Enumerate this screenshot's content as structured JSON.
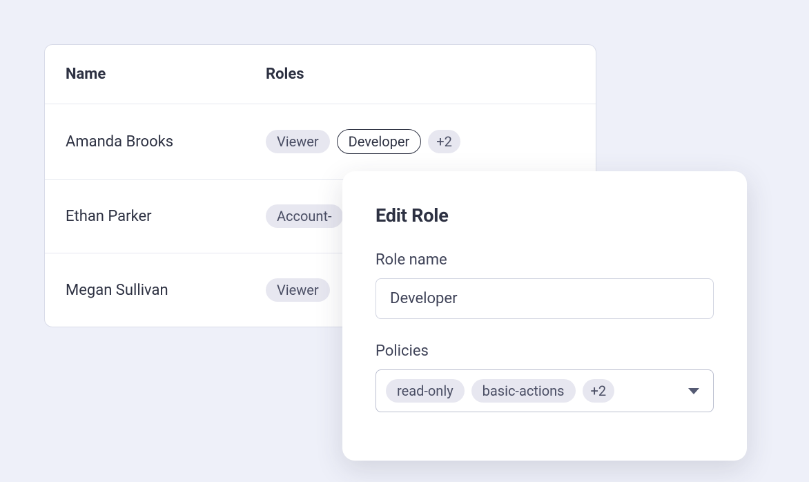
{
  "table": {
    "headers": {
      "name": "Name",
      "roles": "Roles"
    },
    "rows": [
      {
        "name": "Amanda Brooks",
        "roles": [
          "Viewer",
          "Developer"
        ],
        "extraCount": "+2",
        "highlightedIndex": 1
      },
      {
        "name": "Ethan Parker",
        "roles": [
          "Account-"
        ],
        "extraCount": null
      },
      {
        "name": "Megan Sullivan",
        "roles": [
          "Viewer"
        ],
        "extraCount": null
      }
    ]
  },
  "popover": {
    "title": "Edit Role",
    "roleNameLabel": "Role name",
    "roleNameValue": "Developer",
    "policiesLabel": "Policies",
    "policies": [
      "read-only",
      "basic-actions"
    ],
    "policiesExtra": "+2"
  }
}
